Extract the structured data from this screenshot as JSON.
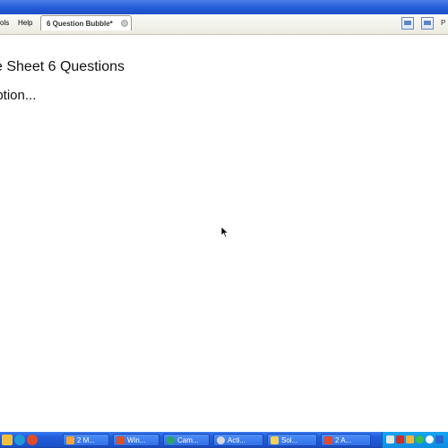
{
  "menubar": {
    "items": [
      {
        "label": "ols"
      },
      {
        "label": "Help"
      }
    ],
    "right_label": "P"
  },
  "tab": {
    "label": "6 Question Bubble*"
  },
  "document": {
    "title": "e Sheet 6 Questions",
    "description": "iption..."
  },
  "taskbar": {
    "tasks": [
      {
        "label": "2 M...",
        "color": "#f3a53b"
      },
      {
        "label": "Win...",
        "color": "#d9502a"
      },
      {
        "label": "Cam...",
        "color": "#2aa36b"
      },
      {
        "label": "Acti...",
        "color": "#d8d8d8"
      },
      {
        "label": "Sol...",
        "color": "#f2d05a"
      },
      {
        "label": "2 A...",
        "color": "#e24a2e"
      }
    ],
    "colors": {
      "bar": "#245edb",
      "tray": "#0f8ce0"
    }
  }
}
